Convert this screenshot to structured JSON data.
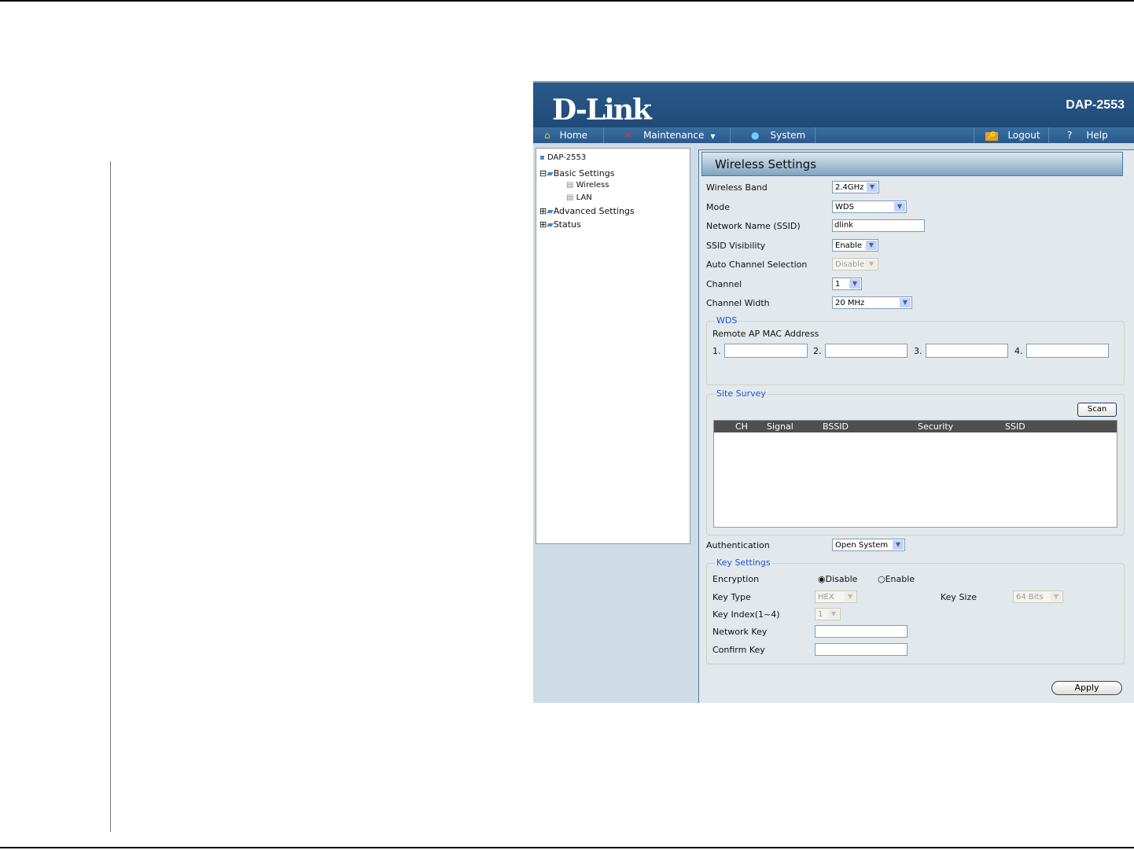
{
  "header": {
    "logo": "D-Link",
    "model": "DAP-2553"
  },
  "nav": {
    "home": "Home",
    "maintenance": "Maintenance",
    "system": "System",
    "logout": "Logout",
    "help": "Help"
  },
  "tree": {
    "root": "DAP-2553",
    "basic": "Basic Settings",
    "wireless": "Wireless",
    "lan": "LAN",
    "advanced": "Advanced Settings",
    "status": "Status"
  },
  "panel": {
    "title": "Wireless Settings"
  },
  "form": {
    "band_label": "Wireless Band",
    "band_value": "2.4GHz",
    "mode_label": "Mode",
    "mode_value": "WDS",
    "ssid_label": "Network Name (SSID)",
    "ssid_value": "dlink",
    "visibility_label": "SSID Visibility",
    "visibility_value": "Enable",
    "autochan_label": "Auto Channel Selection",
    "autochan_value": "Disable",
    "channel_label": "Channel",
    "channel_value": "1",
    "width_label": "Channel Width",
    "width_value": "20 MHz",
    "auth_label": "Authentication",
    "auth_value": "Open System"
  },
  "wds": {
    "legend": "WDS",
    "mac_label": "Remote AP MAC Address",
    "n1": "1.",
    "n2": "2.",
    "n3": "3.",
    "n4": "4."
  },
  "survey": {
    "legend": "Site Survey",
    "scan": "Scan",
    "columns": [
      "CH",
      "Signal",
      "BSSID",
      "Security",
      "SSID"
    ]
  },
  "keys": {
    "legend": "Key Settings",
    "encryption_label": "Encryption",
    "disable": "Disable",
    "enable": "Enable",
    "encryption_selected": "Disable",
    "keytype_label": "Key Type",
    "keytype_value": "HEX",
    "keysize_label": "Key Size",
    "keysize_value": "64 Bits",
    "keyindex_label": "Key Index(1~4)",
    "keyindex_value": "1",
    "netkey_label": "Network Key",
    "confirm_label": "Confirm Key"
  },
  "apply": "Apply"
}
